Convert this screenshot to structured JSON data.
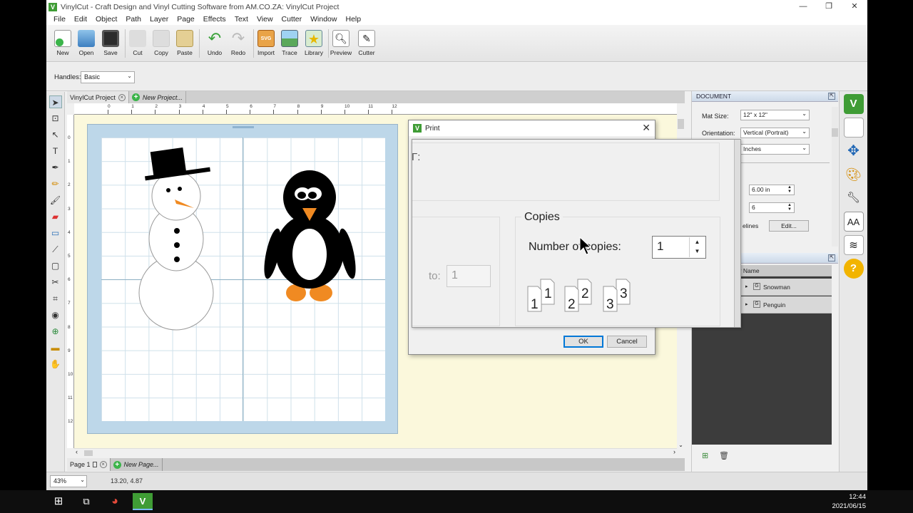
{
  "window": {
    "title": "VinylCut - Craft Design and Vinyl Cutting Software from AM.CO.ZA: VinylCut Project",
    "minimize": "—",
    "restore": "❐",
    "close": "✕"
  },
  "menu": [
    "File",
    "Edit",
    "Object",
    "Path",
    "Layer",
    "Page",
    "Effects",
    "Text",
    "View",
    "Cutter",
    "Window",
    "Help"
  ],
  "toolbar": {
    "new": "New",
    "open": "Open",
    "save": "Save",
    "cut": "Cut",
    "copy": "Copy",
    "paste": "Paste",
    "undo": "Undo",
    "redo": "Redo",
    "import": "Import",
    "trace": "Trace",
    "library": "Library",
    "preview": "Preview",
    "cutter": "Cutter"
  },
  "props": {
    "handles_label": "Handles:",
    "handles_value": "Basic"
  },
  "doc_tabs": {
    "active": "VinylCut Project",
    "new": "New Project..."
  },
  "ruler_h": [
    "0",
    "1",
    "2",
    "3",
    "4",
    "5",
    "6",
    "7",
    "8",
    "9",
    "10",
    "11",
    "12"
  ],
  "ruler_v": [
    "0",
    "1",
    "2",
    "3",
    "4",
    "5",
    "6",
    "7",
    "8",
    "9",
    "10",
    "11",
    "12"
  ],
  "page_tabs": {
    "active": "Page 1",
    "new": "New Page..."
  },
  "document_panel": {
    "title": "DOCUMENT",
    "mat_size_label": "Mat Size:",
    "mat_size_value": "12\" x 12\"",
    "orientation_label": "Orientation:",
    "orientation_value": "Vertical (Portrait)",
    "units_value": "Inches",
    "width_value": "6.00 in",
    "count_value": "6",
    "guidelines_label": "elines",
    "edit_button": "Edit..."
  },
  "layers_panel": {
    "column": "er Name",
    "rows": [
      "Snowman",
      "Penguin"
    ]
  },
  "status": {
    "zoom": "43%",
    "coords": "13.20, 4.87"
  },
  "print_dialog": {
    "title": "Print",
    "ok": "OK",
    "cancel": "Cancel"
  },
  "zoom_view": {
    "partial_label": "Γ:",
    "copies_group": "Copies",
    "number_of_copies_label": "Number of copies:",
    "copies_value": "1",
    "to_label": "to:",
    "to_value": "1"
  },
  "taskbar": {
    "time": "12:44",
    "date": "2021/06/15"
  },
  "colors": {
    "accent": "#3f9c35",
    "mat": "#bdd7e9",
    "workspace": "#fbf8dc",
    "layers_bg": "#3c3c3c"
  }
}
